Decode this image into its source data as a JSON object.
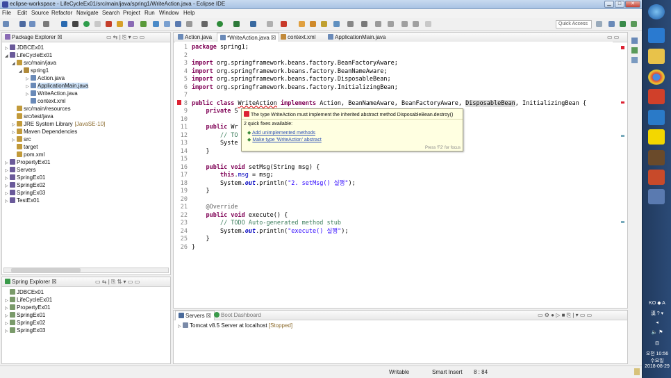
{
  "window": {
    "title": "eclipse-workspace - LifeCycleEx01/src/main/java/spring1/WriteAction.java - Eclipse IDE"
  },
  "menu": [
    "File",
    "Edit",
    "Source",
    "Refactor",
    "Navigate",
    "Search",
    "Project",
    "Run",
    "Window",
    "Help"
  ],
  "toolbar": {
    "quick_access": "Quick Access"
  },
  "package_explorer": {
    "title": "Package Explorer",
    "items": [
      {
        "label": "JDBCEx01",
        "indent": 0,
        "arrow": "▷"
      },
      {
        "label": "LifeCycleEx01",
        "indent": 0,
        "arrow": "◢"
      },
      {
        "label": "src/main/java",
        "indent": 1,
        "arrow": "◢"
      },
      {
        "label": "spring1",
        "indent": 2,
        "arrow": "◢"
      },
      {
        "label": "Action.java",
        "indent": 3,
        "arrow": "▷"
      },
      {
        "label": "ApplicationMain.java",
        "indent": 3,
        "arrow": "▷"
      },
      {
        "label": "WriteAction.java",
        "indent": 3,
        "arrow": "▷"
      },
      {
        "label": "context.xml",
        "indent": 3,
        "arrow": ""
      },
      {
        "label": "src/main/resources",
        "indent": 1,
        "arrow": ""
      },
      {
        "label": "src/test/java",
        "indent": 1,
        "arrow": ""
      },
      {
        "label": "JRE System Library",
        "indent": 1,
        "arrow": "▷",
        "decoration": "[JavaSE-10]"
      },
      {
        "label": "Maven Dependencies",
        "indent": 1,
        "arrow": "▷"
      },
      {
        "label": "src",
        "indent": 1,
        "arrow": "▷"
      },
      {
        "label": "target",
        "indent": 1,
        "arrow": ""
      },
      {
        "label": "pom.xml",
        "indent": 1,
        "arrow": ""
      },
      {
        "label": "PropertyEx01",
        "indent": 0,
        "arrow": "▷"
      },
      {
        "label": "Servers",
        "indent": 0,
        "arrow": "▷"
      },
      {
        "label": "SpringEx01",
        "indent": 0,
        "arrow": "▷"
      },
      {
        "label": "SpringEx02",
        "indent": 0,
        "arrow": "▷"
      },
      {
        "label": "SpringEx03",
        "indent": 0,
        "arrow": "▷"
      },
      {
        "label": "TestEx01",
        "indent": 0,
        "arrow": "▷"
      }
    ]
  },
  "spring_explorer": {
    "title": "Spring Explorer",
    "items": [
      "JDBCEx01",
      "LifeCycleEx01",
      "PropertyEx01",
      "SpringEx01",
      "SpringEx02",
      "SpringEx03"
    ]
  },
  "editor_tabs": [
    {
      "label": "Action.java",
      "active": false
    },
    {
      "label": "*WriteAction.java",
      "active": true
    },
    {
      "label": "context.xml",
      "active": false
    },
    {
      "label": "ApplicationMain.java",
      "active": false
    }
  ],
  "line_numbers": [
    "1",
    "2",
    "3",
    "4",
    "5",
    "6",
    "7",
    "8",
    "9",
    "10",
    "11",
    "12",
    "13",
    "14",
    "15",
    "16",
    "17",
    "18",
    "19",
    "20",
    "21",
    "22",
    "23",
    "24",
    "25",
    "26"
  ],
  "hover": {
    "message": "The type WriteAction must implement the inherited abstract method DisposableBean.destroy()",
    "fixes_count": "2 quick fixes available:",
    "fix1": "Add unimplemented methods",
    "fix2": "Make type 'WriteAction' abstract",
    "footer": "Press 'F2' for focus"
  },
  "servers": {
    "tab1": "Servers",
    "tab2": "Boot Dashboard",
    "row": "Tomcat v8.5 Server at localhost",
    "row_status": "[Stopped]"
  },
  "status": {
    "mode": "Writable",
    "insert": "Smart Insert",
    "position": "8 : 84"
  },
  "tray": {
    "lang1": "KO",
    "lang2": "A",
    "lang3": "漢",
    "ampm": "오전",
    "time": "10:56",
    "day": "수요일",
    "date": "2018-08-29"
  },
  "colors": {
    "keyword": "#7f0055",
    "comment": "#3f7f5f",
    "string": "#2a00ff",
    "field": "#0000c0",
    "hover_bg": "#ffffe1",
    "link": "#2b4fb5"
  }
}
